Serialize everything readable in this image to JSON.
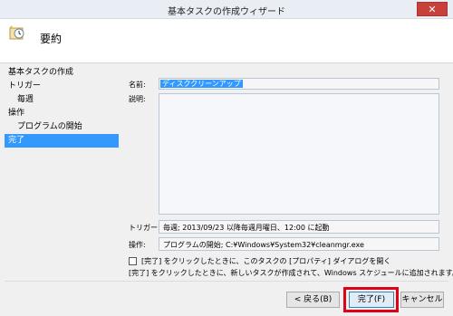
{
  "window": {
    "title": "基本タスクの作成ウィザード",
    "close_symbol": "✕"
  },
  "header": {
    "icon": "task-clock-icon",
    "title": "要約"
  },
  "nav": {
    "items": [
      {
        "label": "基本タスクの作成"
      },
      {
        "label": "トリガー"
      },
      {
        "label": "毎週"
      },
      {
        "label": "操作"
      },
      {
        "label": "プログラムの開始"
      },
      {
        "label": "完了"
      }
    ]
  },
  "form": {
    "name_label": "名前:",
    "name_value": "ディスククリーンアップ",
    "description_label": "説明:",
    "description_value": "",
    "trigger_label": "トリガー:",
    "trigger_value": "毎週; 2013/09/23 以降毎週月曜日、12:00 に起動",
    "action_label": "操作:",
    "action_value": "プログラムの開始; C:¥Windows¥System32¥cleanmgr.exe",
    "checkbox_label": "[完了] をクリックしたときに、このタスクの [プロパティ] ダイアログを開く",
    "checkbox_checked": false,
    "note": "[完了] をクリックしたときに、新しいタスクが作成されて、Windows スケジュールに追加されます。"
  },
  "buttons": {
    "back": "< 戻る(B)",
    "finish": "完了(F)",
    "cancel": "キャンセル"
  },
  "colors": {
    "selection": "#3399ff",
    "highlight": "#e00018",
    "close": "#c7413a"
  }
}
